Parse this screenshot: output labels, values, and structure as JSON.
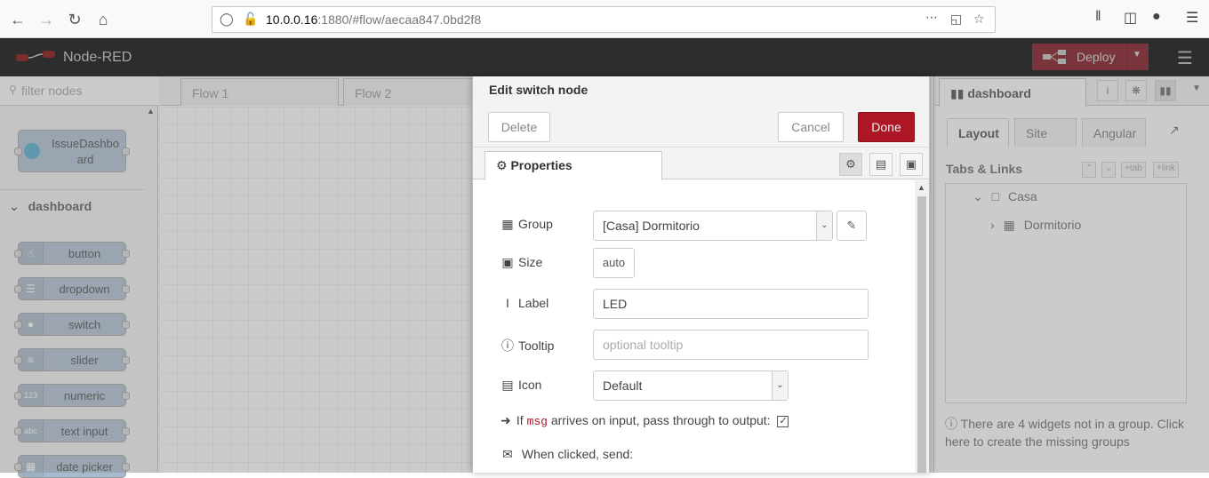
{
  "browser": {
    "url_host": "10.0.0.16",
    "url_rest": ":1880/#flow/aecaa847.0bd2f8"
  },
  "header": {
    "title": "Node-RED",
    "deploy_label": "Deploy"
  },
  "palette": {
    "search_placeholder": "filter nodes",
    "top_node": "IssueDashbo\nard",
    "category": "dashboard",
    "nodes": [
      "button",
      "dropdown",
      "switch",
      "slider",
      "numeric",
      "text input",
      "date picker"
    ]
  },
  "flow_tabs": [
    "Flow 1",
    "Flow 2"
  ],
  "tray": {
    "title": "Edit switch node",
    "delete_label": "Delete",
    "cancel_label": "Cancel",
    "done_label": "Done",
    "properties_tab": "Properties",
    "fields": {
      "group_label": "Group",
      "group_value": "[Casa] Dormitorio",
      "size_label": "Size",
      "size_value": "auto",
      "label_label": "Label",
      "label_value": "LED",
      "tooltip_label": "Tooltip",
      "tooltip_placeholder": "optional tooltip",
      "icon_label": "Icon",
      "icon_value": "Default",
      "pass_prefix": "If",
      "pass_code": "msg",
      "pass_suffix": "arrives on input, pass through to output:",
      "pass_checked": true,
      "clicked_label": "When clicked, send:"
    }
  },
  "sidebar": {
    "tab_label": "dashboard",
    "subtabs": [
      "Layout",
      "Site",
      "Angular"
    ],
    "tabs_links_title": "Tabs & Links",
    "tiny_buttons": [
      "tab",
      "link"
    ],
    "tree": {
      "tab": "Casa",
      "group": "Dormitorio"
    },
    "info": "There are 4 widgets not in a group. Click here to create the missing groups"
  },
  "colors": {
    "deploy": "#8c101c",
    "done": "#ad1625",
    "node_fill": "#a6bbcf"
  }
}
